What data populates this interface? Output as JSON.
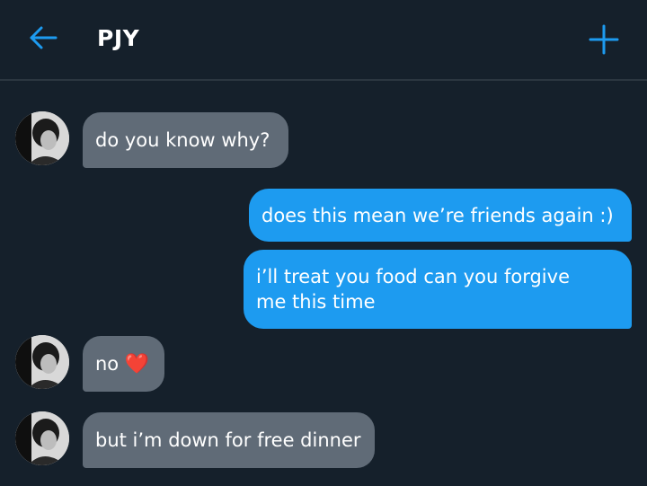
{
  "header": {
    "back_icon": "arrow-left-icon",
    "title": "PJY",
    "add_icon": "plus-icon",
    "accent_color": "#1d9bf0"
  },
  "messages": [
    {
      "direction": "incoming",
      "text": "do you know why?"
    },
    {
      "direction": "outgoing",
      "text": "does this mean we’re friends again :)"
    },
    {
      "direction": "outgoing",
      "lines": [
        "i’ll treat you food can you forgive",
        "me this time"
      ]
    },
    {
      "direction": "incoming",
      "text": "no",
      "emoji": "❤️"
    },
    {
      "direction": "incoming",
      "text": "but i’m down for free dinner"
    }
  ],
  "colors": {
    "background": "#15202b",
    "incoming_bubble": "#606b77",
    "outgoing_bubble": "#1d9bf0",
    "divider": "#2b3640"
  }
}
